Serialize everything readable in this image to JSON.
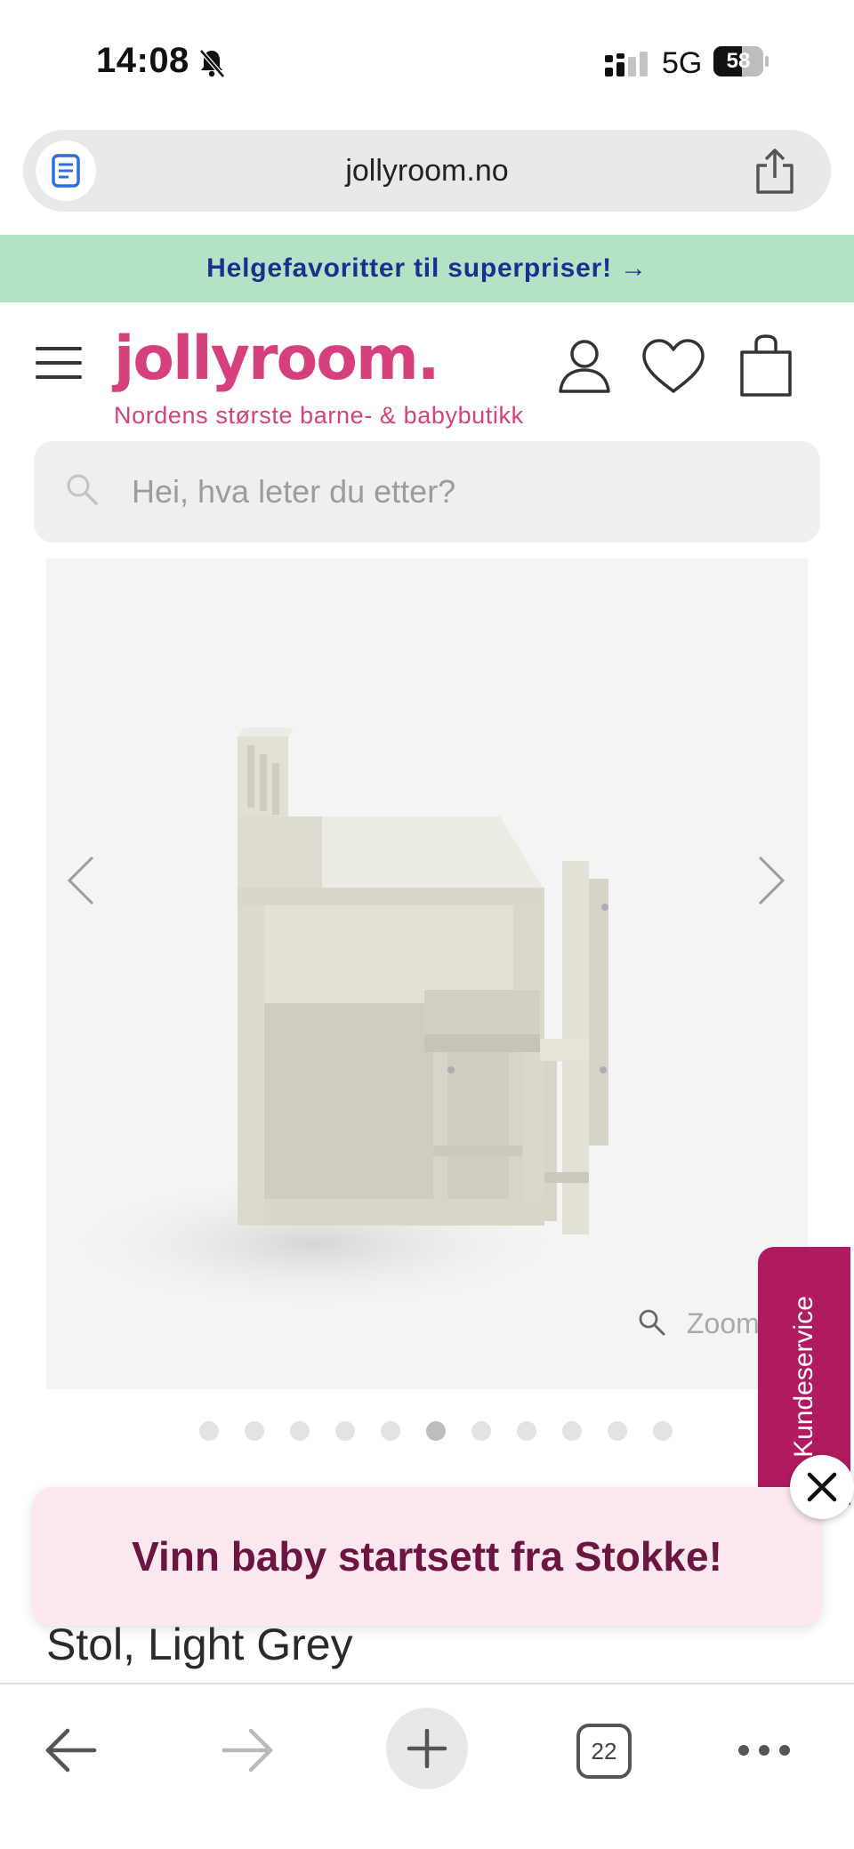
{
  "status_bar": {
    "time": "14:08",
    "network": "5G",
    "battery_percent": "58",
    "battery_level": 0.58,
    "icons": [
      "bell-muted-icon",
      "signal-icon",
      "battery-icon"
    ]
  },
  "browser": {
    "url": "jollyroom.no",
    "tab_count": "22",
    "icons": [
      "reader-icon",
      "share-icon",
      "back-icon",
      "forward-icon",
      "plus-icon",
      "tabs-icon",
      "more-icon"
    ]
  },
  "promo_banner": {
    "text": "Helgefavoritter til superpriser! →"
  },
  "header": {
    "logo": "jollyroom.",
    "tagline": "Nordens største barne- & babybutikk",
    "icons": [
      "menu-icon",
      "account-icon",
      "heart-icon",
      "cart-icon"
    ]
  },
  "search": {
    "placeholder": "Hei, hva leter du etter?"
  },
  "gallery": {
    "zoom_label": "Zoom",
    "dot_count": 11,
    "active_index": 5,
    "icons": [
      "chevron-left-icon",
      "chevron-right-icon",
      "zoom-icon"
    ]
  },
  "customer_service": {
    "label": "Kundeservice"
  },
  "popup": {
    "text": "Vinn baby startsett fra Stokke!"
  },
  "product": {
    "title": "Stol, Light Grey"
  },
  "colors": {
    "brand_pink": "#d6407c",
    "banner_green": "#b3e3c5",
    "banner_text": "#1b2f8f",
    "service_tab": "#b01a61",
    "popup_bg": "#fce8ee",
    "popup_text": "#6b1540"
  }
}
